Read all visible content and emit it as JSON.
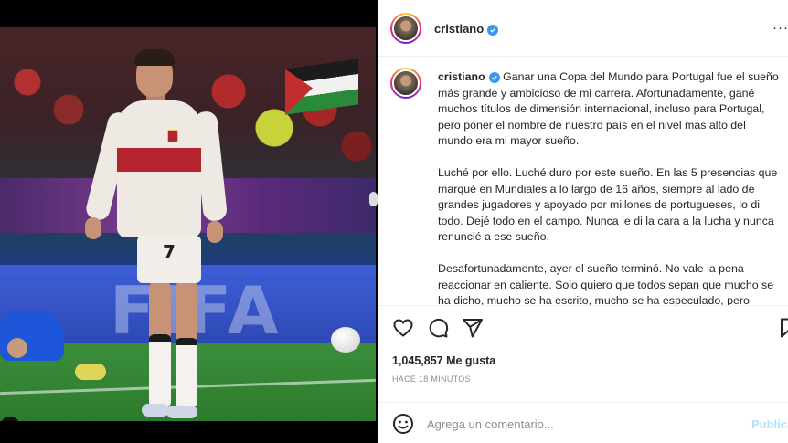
{
  "post": {
    "username": "cristiano",
    "caption": [
      "Ganar una Copa del Mundo para Portugal fue el sueño más grande y ambicioso de mi carrera. Afortunadamente, gané muchos títulos de dimensión internacional, incluso para Portugal, pero poner el nombre de nuestro país en el nivel más alto del mundo era mi mayor sueño.",
      "Luché por ello. Luché duro por este sueño. En las 5 presencias que marqué en Mundiales a lo largo de 16 años, siempre al lado de grandes jugadores y apoyado por millones de portugueses, lo di todo. Dejé todo en el campo. Nunca le di la cara a la lucha y nunca renuncié a ese sueño.",
      "Desafortunadamente, ayer el sueño terminó. No vale la pena reaccionar en caliente. Solo quiero que todos sepan que mucho se ha dicho, mucho se ha escrito, mucho se ha especulado, pero"
    ],
    "likes": "1,045,857 Me gusta",
    "time": "HACE 18 MINUTOS"
  },
  "photo": {
    "board_text": "FIFA",
    "shirt_number": "7"
  },
  "comment": {
    "placeholder": "Agrega un comentario...",
    "publish": "Publica"
  },
  "header": {
    "more": "···"
  },
  "colors": {
    "verified": "#3897f0",
    "publish": "#b2dffc",
    "text": "#262626",
    "muted": "#8e8e8e"
  },
  "icons": [
    "tag-user-icon",
    "heart-icon",
    "comment-icon",
    "share-icon",
    "bookmark-icon",
    "emoji-icon",
    "verified-icon",
    "more-icon"
  ]
}
